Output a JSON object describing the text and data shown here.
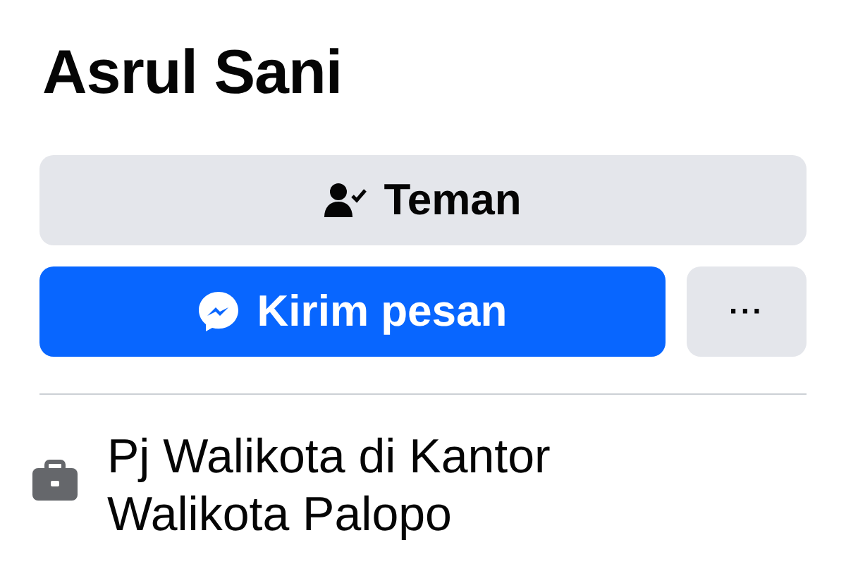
{
  "profile": {
    "name": "Asrul Sani"
  },
  "actions": [
    {
      "kind": "friend",
      "label": "Teman"
    },
    {
      "kind": "message",
      "label": "Kirim pesan"
    },
    {
      "kind": "more",
      "label": "···"
    }
  ],
  "details": [
    {
      "kind": "work",
      "text": "Pj Walikota di Kantor Walikota Palopo"
    }
  ]
}
